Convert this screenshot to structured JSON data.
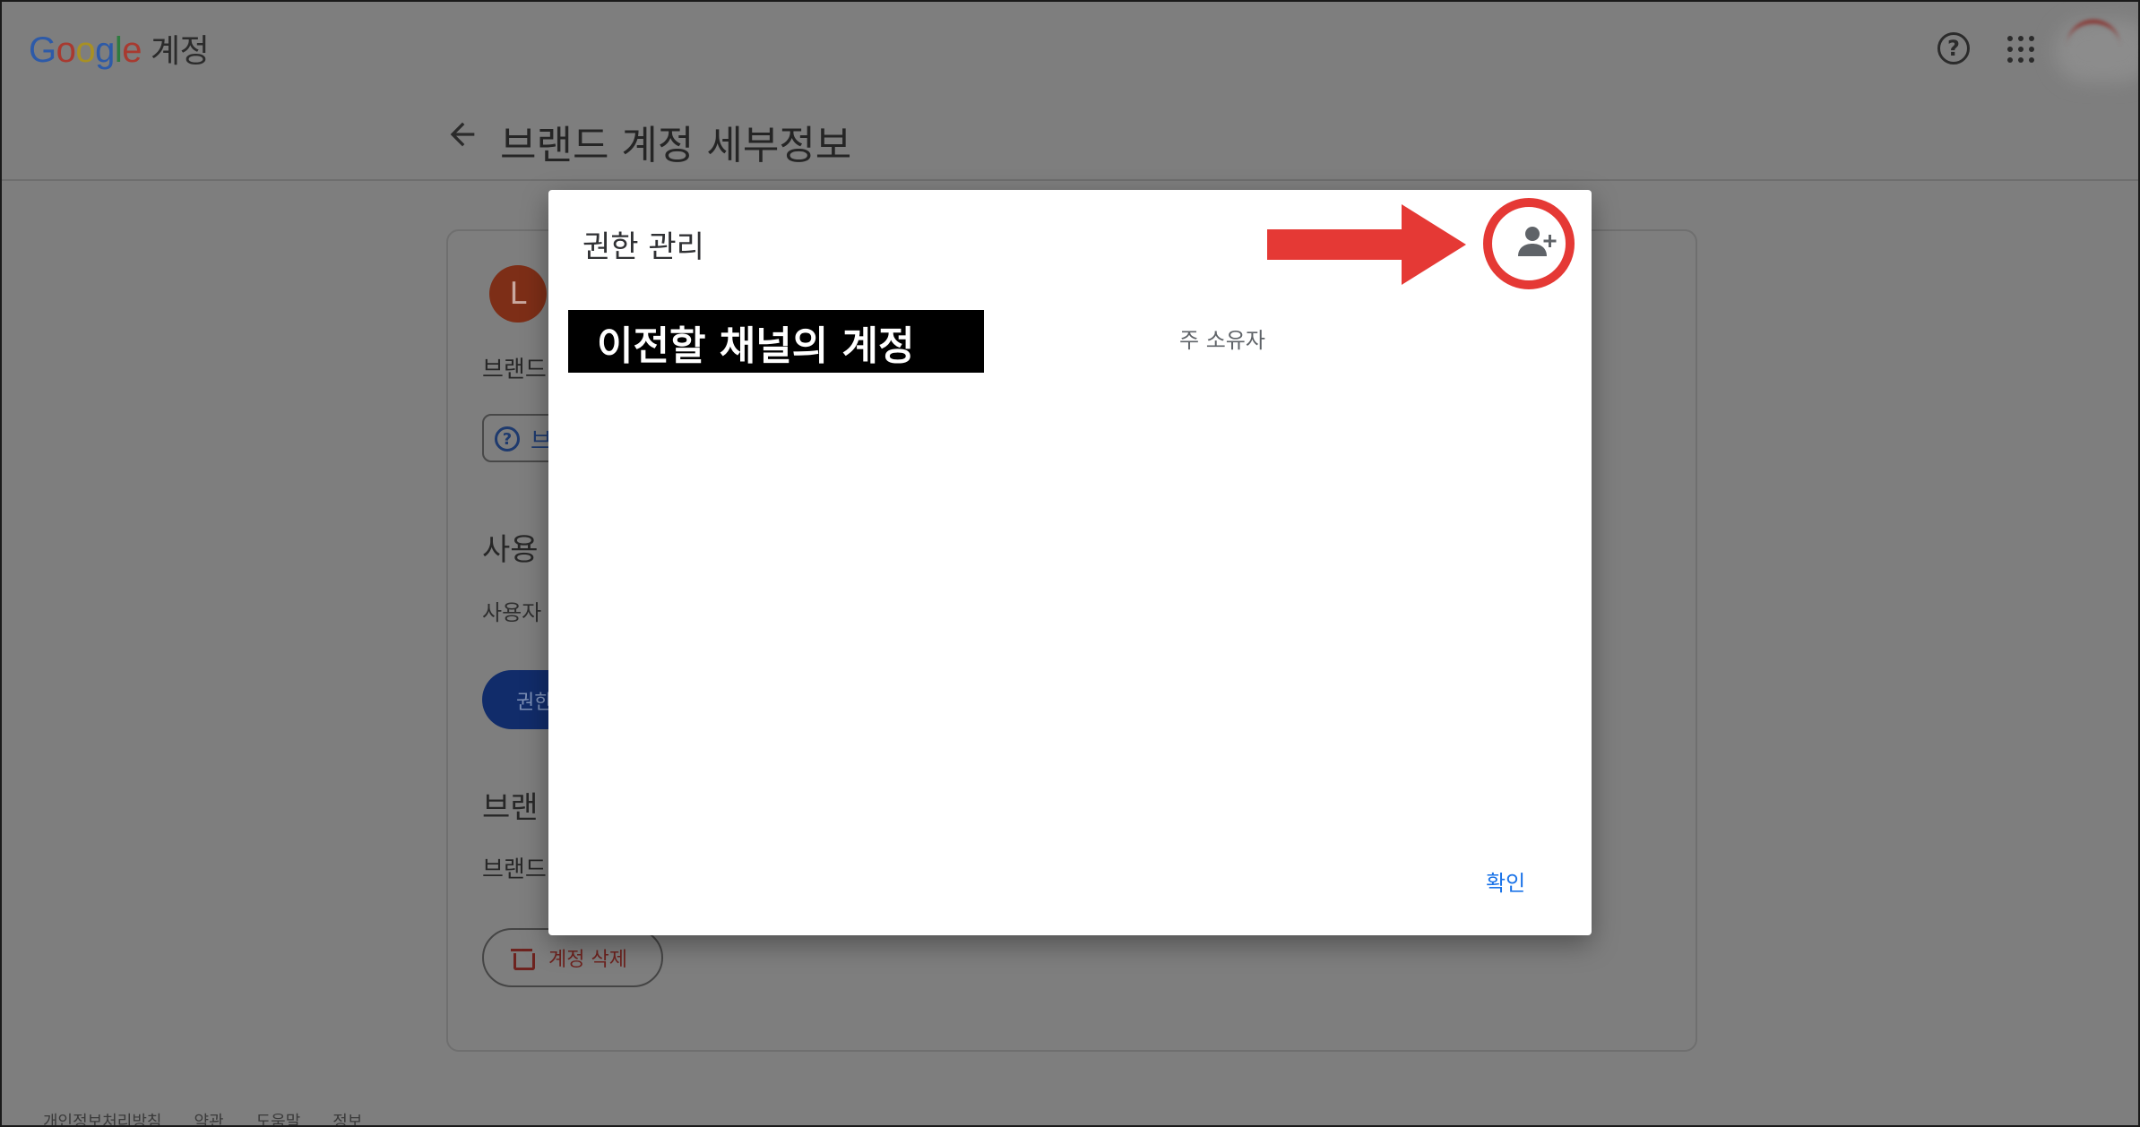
{
  "header": {
    "logo_letters": [
      "G",
      "o",
      "o",
      "g",
      "l",
      "e"
    ],
    "logo_label": "계정",
    "help_icon": "help-circle-icon",
    "apps_icon": "apps-grid-icon"
  },
  "subheader": {
    "back_icon": "arrow-left-icon",
    "title": "브랜드 계정 세부정보"
  },
  "card": {
    "avatar_letter": "L",
    "brand_text_1": "브랜드",
    "chip_icon": "help-circle-icon",
    "chip_text": "브",
    "users_heading": "사용",
    "users_text": "사용자",
    "permission_button": "권한",
    "brand_heading": "브랜",
    "brand_text_2": "브랜드",
    "delete_button": "계정 삭제",
    "delete_icon": "trash-icon"
  },
  "footer": {
    "links": [
      "개인정보처리방침",
      "약관",
      "도움말",
      "정보"
    ]
  },
  "dialog": {
    "title": "권한 관리",
    "add_user_icon": "person-add-icon",
    "owner_label": "주 소유자",
    "confirm": "확인"
  },
  "annotation": {
    "label": "이전할 채널의 계정",
    "arrow_color": "#e53935",
    "highlight_color": "#e53935"
  },
  "colors": {
    "accent": "#1a73e8",
    "annotation": "#e53935",
    "scrim_page": "#7e7e7e"
  }
}
